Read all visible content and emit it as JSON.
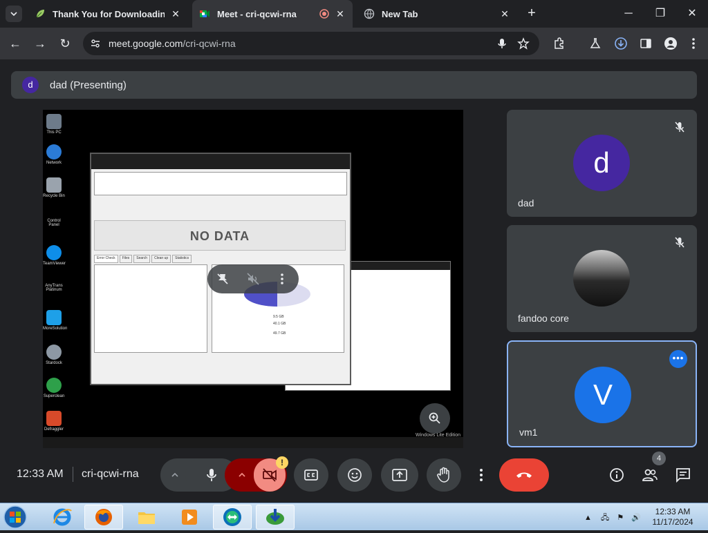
{
  "browser": {
    "tabs": [
      {
        "title": "Thank You for Downloading Ea",
        "active": false,
        "recording": false
      },
      {
        "title": "Meet - cri-qcwi-rna",
        "active": true,
        "recording": true
      },
      {
        "title": "New Tab",
        "active": false,
        "recording": false
      }
    ],
    "url_host": "meet.google.com",
    "url_path": "/cri-qcwi-rna",
    "colors": {
      "frame": "#202124",
      "toolbar": "#35363a"
    }
  },
  "meet": {
    "presenting": {
      "avatar_letter": "d",
      "label": "dad (Presenting)"
    },
    "shared_screen": {
      "no_data": "NO DATA",
      "watermark": "Windows Lite Edition",
      "desktop_icons": [
        "This PC",
        "Network",
        "Recycle Bin",
        "Control Panel",
        "TeamViewer",
        "AnyTrans Platinum",
        "MoreSolution",
        "Stardock",
        "Superclean",
        "Defraggler"
      ],
      "storage": {
        "used": "9.5 GB",
        "free": "40.1 GB",
        "capacity": "49.7 GB"
      },
      "tabs": [
        "Error Check",
        "Files",
        "Search",
        "Clean up",
        "Statistics"
      ]
    },
    "participants": [
      {
        "name": "dad",
        "avatar_letter": "d",
        "avatar_color": "#4527a0",
        "muted": true
      },
      {
        "name": "fandoo core",
        "avatar_letter": "",
        "avatar_color": "#1c1c1c",
        "muted": true
      },
      {
        "name": "vm1",
        "avatar_letter": "V",
        "avatar_color": "#1a73e8",
        "muted": false,
        "active": true
      }
    ],
    "bottom": {
      "time": "12:33 AM",
      "meeting_code": "cri-qcwi-rna",
      "people_count": "4",
      "warning_badge": "!"
    }
  },
  "taskbar": {
    "time": "12:33 AM",
    "date": "11/17/2024",
    "apps": [
      "internet-explorer",
      "firefox",
      "file-explorer",
      "media-player",
      "teamviewer-meet",
      "download-manager"
    ]
  }
}
